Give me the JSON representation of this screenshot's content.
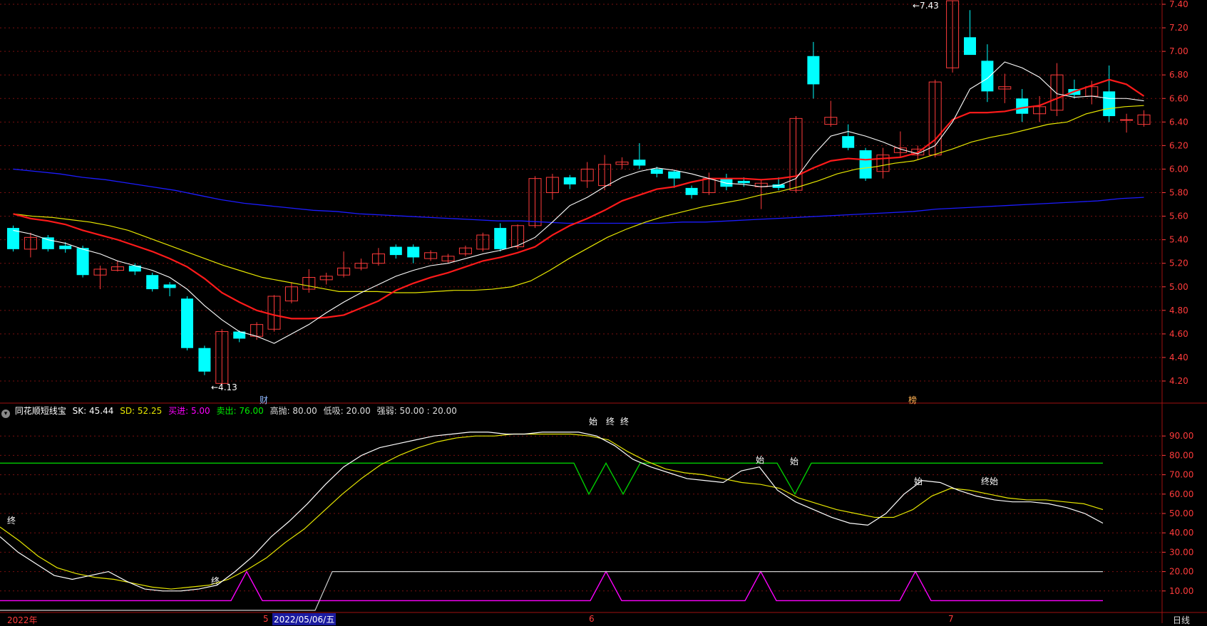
{
  "legend": {
    "name": "同花顺短线宝",
    "sk": "SK: 45.44",
    "sd": "SD: 52.25",
    "buy": "买进: 5.00",
    "sell": "卖出: 76.00",
    "high": "高抛: 80.00",
    "low": "低吸: 20.00",
    "strength": "强弱: 50.00 : 20.00"
  },
  "markers": {
    "cai": "财",
    "bang": "榜",
    "low_label": "←4.13",
    "high_label": "←7.43",
    "day_line": "日线"
  },
  "bottom_axis": {
    "year": "2022年",
    "m5": "5",
    "date_box": "2022/05/06/五",
    "m6": "6",
    "m7": "7"
  },
  "colors": {
    "up": "#ff3b3b",
    "down": "#00ffff",
    "ma_white": "#ffffff",
    "ma_red": "#ff1a1a",
    "ma_yellow": "#e6e600",
    "ma_blue": "#1c1cff",
    "sd_yellow": "#e6e600",
    "sk_white": "#ffffff",
    "sell_green": "#00cc00",
    "buy_magenta": "#ff00ff",
    "strength_gray": "#cccccc"
  },
  "chart_data": [
    {
      "type": "candlestick",
      "y_ticks": [
        "7.40",
        "7.20",
        "7.00",
        "6.80",
        "6.60",
        "6.40",
        "6.20",
        "6.00",
        "5.80",
        "5.60",
        "5.40",
        "5.20",
        "5.00",
        "4.80",
        "4.60",
        "4.40",
        "4.20"
      ],
      "ylim": [
        4.1,
        7.45
      ],
      "candles": [
        [
          5.5,
          5.32,
          5.52,
          5.3
        ],
        [
          5.32,
          5.42,
          5.46,
          5.25
        ],
        [
          5.42,
          5.32,
          5.44,
          5.3
        ],
        [
          5.35,
          5.32,
          5.38,
          5.29
        ],
        [
          5.33,
          5.1,
          5.35,
          5.08
        ],
        [
          5.1,
          5.15,
          5.18,
          4.98
        ],
        [
          5.14,
          5.17,
          5.22,
          5.13
        ],
        [
          5.18,
          5.13,
          5.2,
          5.1
        ],
        [
          5.1,
          4.98,
          5.12,
          4.96
        ],
        [
          5.02,
          4.99,
          5.04,
          4.92
        ],
        [
          4.9,
          4.48,
          4.92,
          4.46
        ],
        [
          4.48,
          4.28,
          4.5,
          4.25
        ],
        [
          4.18,
          4.62,
          4.64,
          4.13
        ],
        [
          4.62,
          4.56,
          4.63,
          4.53
        ],
        [
          4.58,
          4.68,
          4.7,
          4.55
        ],
        [
          4.64,
          4.92,
          4.93,
          4.62
        ],
        [
          4.88,
          5.0,
          5.04,
          4.86
        ],
        [
          4.98,
          5.08,
          5.15,
          4.95
        ],
        [
          5.06,
          5.09,
          5.12,
          5.02
        ],
        [
          5.1,
          5.16,
          5.3,
          5.08
        ],
        [
          5.16,
          5.2,
          5.24,
          5.14
        ],
        [
          5.2,
          5.28,
          5.33,
          5.18
        ],
        [
          5.34,
          5.27,
          5.36,
          5.24
        ],
        [
          5.34,
          5.25,
          5.36,
          5.2
        ],
        [
          5.24,
          5.29,
          5.31,
          5.22
        ],
        [
          5.22,
          5.26,
          5.28,
          5.2
        ],
        [
          5.28,
          5.33,
          5.35,
          5.26
        ],
        [
          5.32,
          5.44,
          5.46,
          5.3
        ],
        [
          5.5,
          5.32,
          5.54,
          5.3
        ],
        [
          5.34,
          5.52,
          5.53,
          5.32
        ],
        [
          5.52,
          5.92,
          5.94,
          5.5
        ],
        [
          5.8,
          5.93,
          5.96,
          5.74
        ],
        [
          5.93,
          5.87,
          5.95,
          5.83
        ],
        [
          5.9,
          6.0,
          6.06,
          5.84
        ],
        [
          5.86,
          6.04,
          6.12,
          5.82
        ],
        [
          6.04,
          6.06,
          6.1,
          6.0
        ],
        [
          6.08,
          6.03,
          6.22,
          6.0
        ],
        [
          6.0,
          5.96,
          6.02,
          5.93
        ],
        [
          5.98,
          5.92,
          5.99,
          5.84
        ],
        [
          5.84,
          5.78,
          5.86,
          5.75
        ],
        [
          5.8,
          5.92,
          5.97,
          5.78
        ],
        [
          5.92,
          5.85,
          5.96,
          5.82
        ],
        [
          5.9,
          5.88,
          5.93,
          5.85
        ],
        [
          5.85,
          5.88,
          5.91,
          5.66
        ],
        [
          5.87,
          5.84,
          5.93,
          5.82
        ],
        [
          5.82,
          6.43,
          6.45,
          5.8
        ],
        [
          6.96,
          6.72,
          7.08,
          6.6
        ],
        [
          6.38,
          6.44,
          6.58,
          6.36
        ],
        [
          6.28,
          6.18,
          6.38,
          6.16
        ],
        [
          6.16,
          5.92,
          6.18,
          5.9
        ],
        [
          5.98,
          6.12,
          6.18,
          5.92
        ],
        [
          6.14,
          6.18,
          6.32,
          6.1
        ],
        [
          6.12,
          6.17,
          6.2,
          6.08
        ],
        [
          6.12,
          6.74,
          6.76,
          6.1
        ],
        [
          6.86,
          7.43,
          7.43,
          6.82
        ],
        [
          7.12,
          6.97,
          7.35,
          6.98
        ],
        [
          6.92,
          6.66,
          7.06,
          6.57
        ],
        [
          6.68,
          6.7,
          6.81,
          6.56
        ],
        [
          6.6,
          6.47,
          6.68,
          6.4
        ],
        [
          6.47,
          6.53,
          6.62,
          6.4
        ],
        [
          6.5,
          6.8,
          6.9,
          6.45
        ],
        [
          6.68,
          6.63,
          6.76,
          6.6
        ],
        [
          6.62,
          6.7,
          6.75,
          6.55
        ],
        [
          6.66,
          6.45,
          6.88,
          6.4
        ],
        [
          6.42,
          6.42,
          6.47,
          6.31
        ],
        [
          6.38,
          6.46,
          6.5,
          6.36
        ]
      ],
      "ma_white": [
        5.48,
        5.45,
        5.4,
        5.37,
        5.32,
        5.28,
        5.22,
        5.18,
        5.14,
        5.08,
        4.98,
        4.84,
        4.72,
        4.62,
        4.58,
        4.52,
        4.6,
        4.68,
        4.78,
        4.87,
        4.95,
        5.02,
        5.09,
        5.14,
        5.18,
        5.2,
        5.24,
        5.28,
        5.31,
        5.35,
        5.42,
        5.55,
        5.69,
        5.76,
        5.85,
        5.93,
        5.98,
        6.01,
        5.99,
        5.96,
        5.92,
        5.88,
        5.87,
        5.85,
        5.86,
        5.92,
        6.12,
        6.28,
        6.32,
        6.28,
        6.23,
        6.17,
        6.13,
        6.2,
        6.4,
        6.68,
        6.77,
        6.91,
        6.86,
        6.78,
        6.64,
        6.61,
        6.62,
        6.6,
        6.6,
        6.58
      ],
      "ma_red": [
        5.62,
        5.58,
        5.56,
        5.53,
        5.48,
        5.44,
        5.4,
        5.35,
        5.3,
        5.24,
        5.17,
        5.07,
        4.95,
        4.87,
        4.8,
        4.76,
        4.73,
        4.73,
        4.74,
        4.76,
        4.82,
        4.88,
        4.97,
        5.03,
        5.08,
        5.12,
        5.17,
        5.22,
        5.25,
        5.29,
        5.34,
        5.44,
        5.52,
        5.58,
        5.65,
        5.73,
        5.78,
        5.83,
        5.85,
        5.89,
        5.92,
        5.92,
        5.92,
        5.91,
        5.92,
        5.94,
        6.01,
        6.07,
        6.09,
        6.08,
        6.09,
        6.1,
        6.14,
        6.25,
        6.42,
        6.48,
        6.48,
        6.49,
        6.52,
        6.54,
        6.6,
        6.66,
        6.71,
        6.76,
        6.72,
        6.62,
        6.58
      ],
      "ma_yellow": [
        5.62,
        5.6,
        5.59,
        5.57,
        5.55,
        5.52,
        5.48,
        5.42,
        5.36,
        5.3,
        5.24,
        5.18,
        5.13,
        5.08,
        5.05,
        5.02,
        4.99,
        4.96,
        4.96,
        4.96,
        4.95,
        4.95,
        4.96,
        4.97,
        4.97,
        4.98,
        5.0,
        5.05,
        5.14,
        5.24,
        5.33,
        5.42,
        5.49,
        5.55,
        5.6,
        5.64,
        5.68,
        5.71,
        5.74,
        5.78,
        5.81,
        5.85,
        5.9,
        5.96,
        6.0,
        6.02,
        6.05,
        6.07,
        6.12,
        6.17,
        6.23,
        6.27,
        6.3,
        6.34,
        6.38,
        6.4,
        6.47,
        6.51,
        6.53,
        6.54
      ],
      "ma_blue": [
        6.0,
        5.98,
        5.96,
        5.93,
        5.91,
        5.88,
        5.85,
        5.82,
        5.78,
        5.74,
        5.71,
        5.69,
        5.67,
        5.65,
        5.64,
        5.62,
        5.61,
        5.6,
        5.59,
        5.58,
        5.57,
        5.56,
        5.56,
        5.55,
        5.54,
        5.54,
        5.54,
        5.54,
        5.54,
        5.55,
        5.55,
        5.56,
        5.57,
        5.58,
        5.59,
        5.6,
        5.61,
        5.62,
        5.63,
        5.64,
        5.66,
        5.67,
        5.68,
        5.69,
        5.7,
        5.71,
        5.72,
        5.73,
        5.75,
        5.76
      ],
      "lowest": 4.13,
      "highest": 7.43
    },
    {
      "type": "line",
      "title": "同花顺短线宝",
      "y_ticks": [
        "90.00",
        "80.00",
        "70.00",
        "60.00",
        "50.00",
        "40.00",
        "30.00",
        "20.00",
        "10.00"
      ],
      "ylim": [
        0,
        100
      ],
      "series": [
        {
          "name": "SK",
          "values": [
            38,
            30,
            24,
            18,
            16,
            18,
            20,
            15,
            11,
            10,
            10,
            11,
            13,
            20,
            28,
            38,
            46,
            55,
            65,
            74,
            80,
            84,
            86,
            88,
            90,
            91,
            92,
            92,
            91,
            91,
            92,
            92,
            92,
            90,
            85,
            78,
            74,
            71,
            68,
            67,
            66,
            72,
            74,
            62,
            56,
            52,
            48,
            45,
            44,
            50,
            60,
            67,
            66,
            62,
            59,
            57,
            56,
            56,
            55,
            53,
            50,
            45
          ],
          "color": "#ffffff"
        },
        {
          "name": "SD",
          "values": [
            43,
            36,
            28,
            22,
            19,
            17,
            16,
            14,
            12,
            11,
            12,
            13,
            16,
            21,
            27,
            35,
            42,
            51,
            60,
            68,
            75,
            80,
            84,
            87,
            89,
            90,
            90,
            91,
            91,
            91,
            91,
            90,
            88,
            82,
            77,
            73,
            71,
            70,
            68,
            66,
            65,
            63,
            58,
            55,
            52,
            50,
            48,
            48,
            52,
            59,
            63,
            62,
            60,
            58,
            57,
            57,
            56,
            55,
            52
          ],
          "color": "#e6e600"
        },
        {
          "name": "卖出",
          "value": 76.0,
          "color": "#00cc00"
        },
        {
          "name": "买进",
          "value": 5.0,
          "color": "#ff00ff"
        },
        {
          "name": "强弱",
          "value": 20.0,
          "color": "#cccccc"
        }
      ],
      "labels": [
        "终",
        "始",
        "终",
        "始",
        "终",
        "始",
        "终",
        "始",
        "终",
        "始"
      ]
    }
  ]
}
